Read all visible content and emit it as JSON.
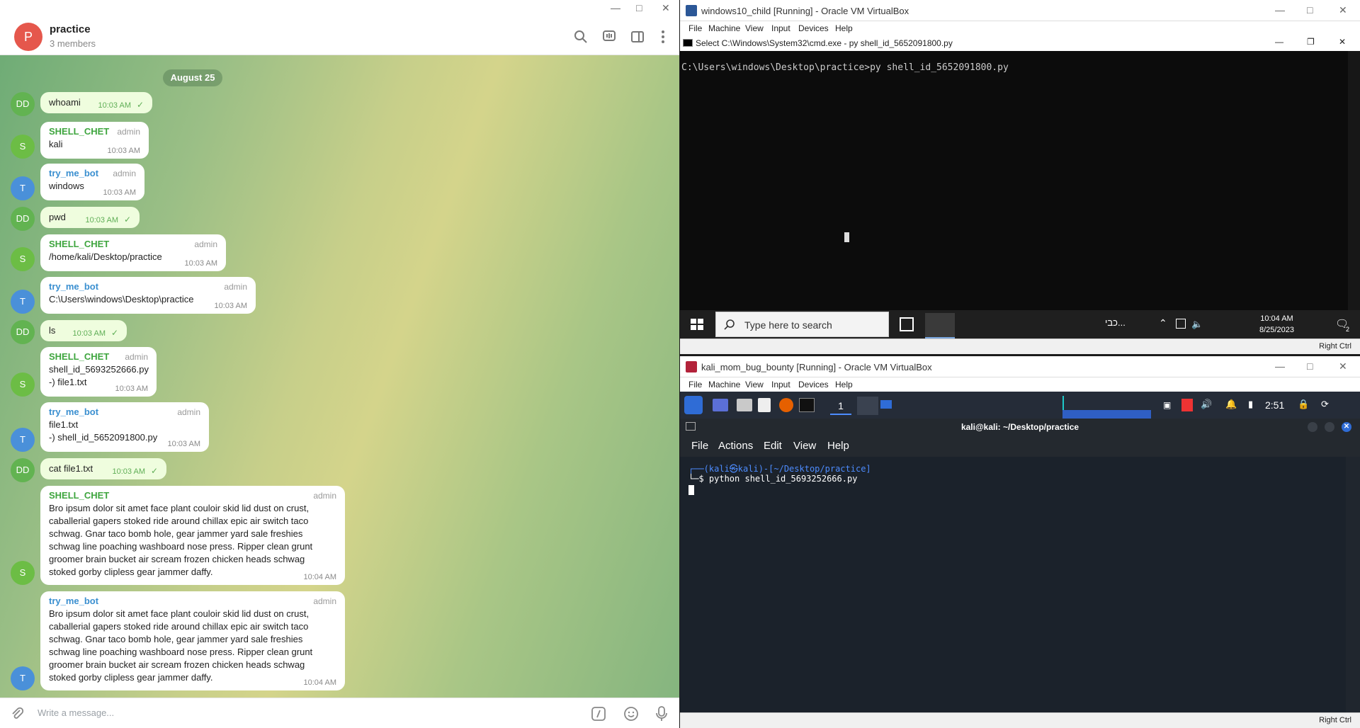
{
  "telegram": {
    "chat_name": "practice",
    "members": "3 members",
    "avatar_letter": "P",
    "date_pill": "August 25",
    "input_placeholder": "Write a message...",
    "messages": [
      {
        "avatar": "DD",
        "text": "whoami",
        "time": "10:03 AM"
      },
      {
        "avatar": "S",
        "sender": "SHELL_CHET",
        "role": "admin",
        "text": "kali",
        "time": "10:03 AM"
      },
      {
        "avatar": "T",
        "sender": "try_me_bot",
        "role": "admin",
        "text": "windows",
        "time": "10:03 AM"
      },
      {
        "avatar": "DD",
        "text": "pwd",
        "time": "10:03 AM"
      },
      {
        "avatar": "S",
        "sender": "SHELL_CHET",
        "role": "admin",
        "text": "/home/kali/Desktop/practice",
        "time": "10:03 AM"
      },
      {
        "avatar": "T",
        "sender": "try_me_bot",
        "role": "admin",
        "text": "C:\\Users\\windows\\Desktop\\practice",
        "time": "10:03 AM"
      },
      {
        "avatar": "DD",
        "text": "ls",
        "time": "10:03 AM"
      },
      {
        "avatar": "S",
        "sender": "SHELL_CHET",
        "role": "admin",
        "text": "shell_id_5693252666.py\n-) file1.txt",
        "time": "10:03 AM"
      },
      {
        "avatar": "T",
        "sender": "try_me_bot",
        "role": "admin",
        "text": "file1.txt\n-) shell_id_5652091800.py",
        "time": "10:03 AM"
      },
      {
        "avatar": "DD",
        "text": "cat file1.txt",
        "time": "10:03 AM"
      },
      {
        "avatar": "S",
        "sender": "SHELL_CHET",
        "role": "admin",
        "text": "Bro ipsum dolor sit amet face plant couloir skid lid dust on crust,\ncaballerial gapers stoked ride around chillax epic air switch taco\nschwag. Gnar taco bomb hole, gear jammer yard sale freshies\nschwag line poaching washboard nose press. Ripper clean grunt\ngroomer brain bucket air scream frozen chicken heads schwag\nstoked gorby clipless gear jammer daffy.",
        "time": "10:04 AM"
      },
      {
        "avatar": "T",
        "sender": "try_me_bot",
        "role": "admin",
        "text": "Bro ipsum dolor sit amet face plant couloir skid lid dust on crust,\ncaballerial gapers stoked ride around chillax epic air switch taco\nschwag. Gnar taco bomb hole, gear jammer yard sale freshies\nschwag line poaching washboard nose press. Ripper clean grunt\ngroomer brain bucket air scream frozen chicken heads schwag\nstoked gorby clipless gear jammer daffy.",
        "time": "10:04 AM"
      }
    ]
  },
  "vbox_windows": {
    "title": "windows10_child [Running] - Oracle VM VirtualBox",
    "menu": [
      "File",
      "Machine",
      "View",
      "Input",
      "Devices",
      "Help"
    ],
    "cmd_title": "Select C:\\Windows\\System32\\cmd.exe - py  shell_id_5652091800.py",
    "cmd_line": "C:\\Users\\windows\\Desktop\\practice>py shell_id_5652091800.py",
    "search_placeholder": "Type here to search",
    "clock_time": "10:04 AM",
    "clock_date": "8/25/2023",
    "lang": "כבי...",
    "notif_count": "2",
    "host_key": "Right Ctrl"
  },
  "vbox_kali": {
    "title": "kali_mom_bug_bounty [Running] - Oracle VM VirtualBox",
    "menu": [
      "File",
      "Machine",
      "View",
      "Input",
      "Devices",
      "Help"
    ],
    "workspace": "1",
    "clock": "2:51",
    "term_title": "kali@kali: ~/Desktop/practice",
    "term_menu": [
      "File",
      "Actions",
      "Edit",
      "View",
      "Help"
    ],
    "prompt": "┌──(kali㉿kali)-[~/Desktop/practice]",
    "command": "└─$ python shell_id_5693252666.py",
    "host_key": "Right Ctrl"
  }
}
